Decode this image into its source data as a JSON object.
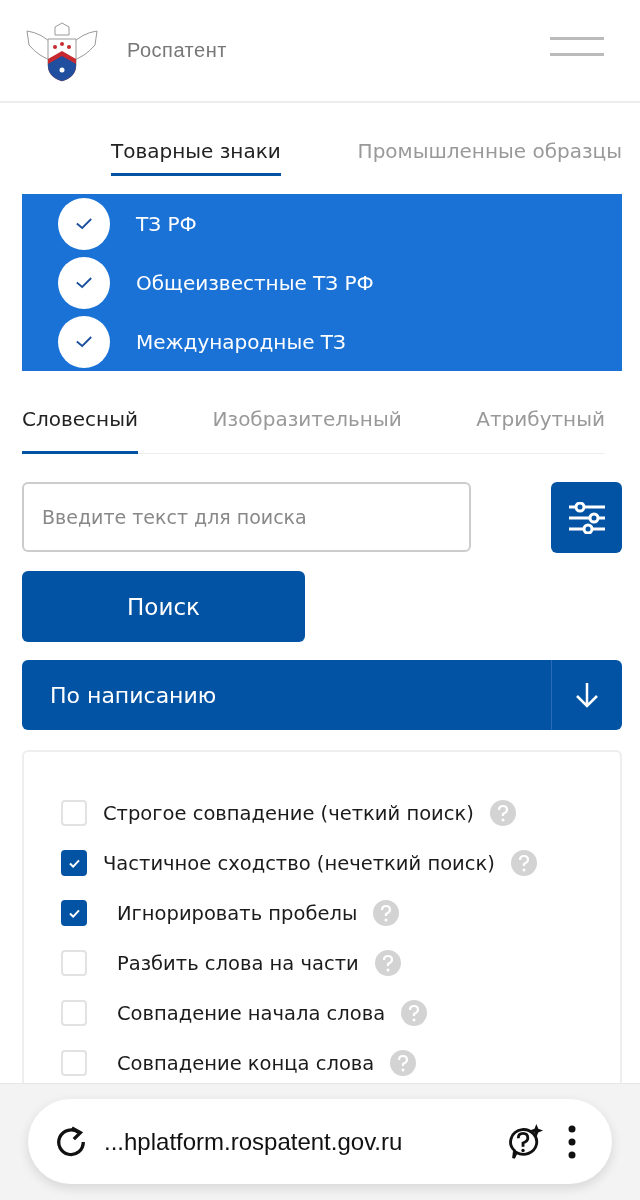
{
  "header": {
    "site_name": "Роспатент"
  },
  "registry_tabs": [
    {
      "label": "Товарные знаки",
      "selected": true
    },
    {
      "label": "Промышленные образцы",
      "selected": false
    }
  ],
  "registries": [
    {
      "label": "ТЗ РФ",
      "checked": true
    },
    {
      "label": "Общеизвестные ТЗ РФ",
      "checked": true
    },
    {
      "label": "Международные ТЗ",
      "checked": true
    }
  ],
  "search_tabs": [
    {
      "label": "Словесный",
      "selected": true
    },
    {
      "label": "Изобразительный",
      "selected": false
    },
    {
      "label": "Атрибутный",
      "selected": false
    }
  ],
  "search": {
    "placeholder": "Введите текст для поиска",
    "button": "Поиск"
  },
  "mode_dropdown": {
    "value": "По написанию"
  },
  "options": [
    {
      "label": "Строгое совпадение (четкий поиск)",
      "checked": false
    },
    {
      "label": "Частичное сходство (нечеткий поиск)",
      "checked": true,
      "children": [
        {
          "label": "Игнорировать пробелы",
          "checked": true
        },
        {
          "label": "Разбить слова на части",
          "checked": false
        },
        {
          "label": "Совпадение начала слова",
          "checked": false
        },
        {
          "label": "Совпадение конца слова",
          "checked": false
        }
      ]
    }
  ],
  "browser_bar": {
    "url": "...hplatform.rospatent.gov.ru"
  }
}
